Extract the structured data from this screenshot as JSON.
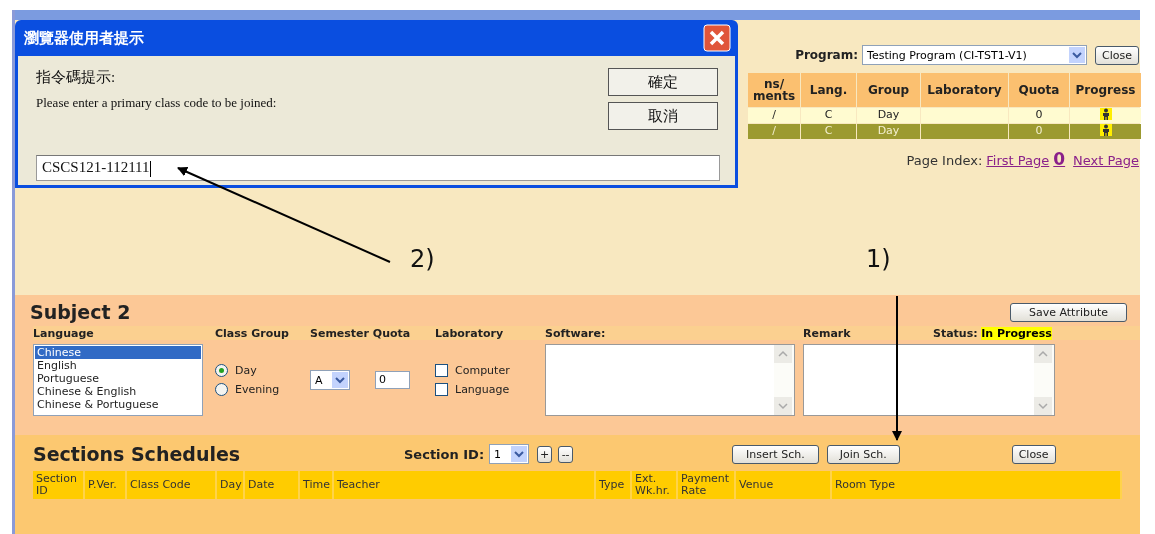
{
  "dialog": {
    "title": "瀏覽器使用者提示",
    "prompt_label": "指令碼提示:",
    "message": "Please enter a primary class code to be joined:",
    "value": "CSCS121-112111",
    "buttons": [
      "確定",
      "取消"
    ]
  },
  "program": {
    "label": "Program:",
    "value": "Testing Program (CI-TST1-V1)",
    "close": "Close"
  },
  "table": {
    "columns": [
      "ns/ ments",
      "Lang.",
      "Group",
      "Laboratory",
      "Quota",
      "Progress"
    ],
    "rows": [
      {
        "column_1": "/",
        "lang": "C",
        "group": "Day",
        "quota": "0",
        "selected": false
      },
      {
        "column_1": "/",
        "lang": "C",
        "group": "Day",
        "quota": "0",
        "selected": true
      }
    ]
  },
  "page_index": {
    "label": "Page Index:",
    "first": "First Page",
    "current": "0",
    "next": "Next Page"
  },
  "subject": {
    "title": "Subject 2",
    "save": "Save Attribute",
    "language_label": "Language",
    "class_group_label": "Class Group",
    "quota_label": "Semester Quota",
    "laboratory_label": "Laboratory",
    "software_label": "Software:",
    "remark_label": "Remark",
    "status_label": "Status:",
    "status": "In Progress",
    "languages": [
      {
        "label": "Chinese",
        "selected": true
      },
      {
        "label": "English",
        "selected": false
      },
      {
        "label": "Portuguese",
        "selected": false
      },
      {
        "label": "Chinese & English",
        "selected": false
      },
      {
        "label": "Chinese & Portuguese",
        "selected": false
      }
    ],
    "class_groups": [
      {
        "label": "Day",
        "selected": true
      },
      {
        "label": "Evening",
        "selected": false
      }
    ],
    "semester": "A",
    "quota": "0",
    "laboratories": [
      {
        "label": "Computer",
        "checked": false
      },
      {
        "label": "Language",
        "checked": false
      }
    ]
  },
  "schedules": {
    "title": "Sections Schedules",
    "section_label": "Section ID:",
    "section_value": "1",
    "add": "+",
    "remove": "--",
    "buttons": [
      "Insert Sch.",
      "Join Sch."
    ],
    "close": "Close",
    "columns": [
      "Section ID",
      "P.Ver.",
      "Class Code",
      "Day",
      "Date",
      "Time",
      "Teacher",
      "Type",
      "Ext. Wk.hr.",
      "Payment Rate",
      "Venue",
      "Room Type"
    ]
  },
  "annotations": [
    "2)",
    "1)"
  ]
}
